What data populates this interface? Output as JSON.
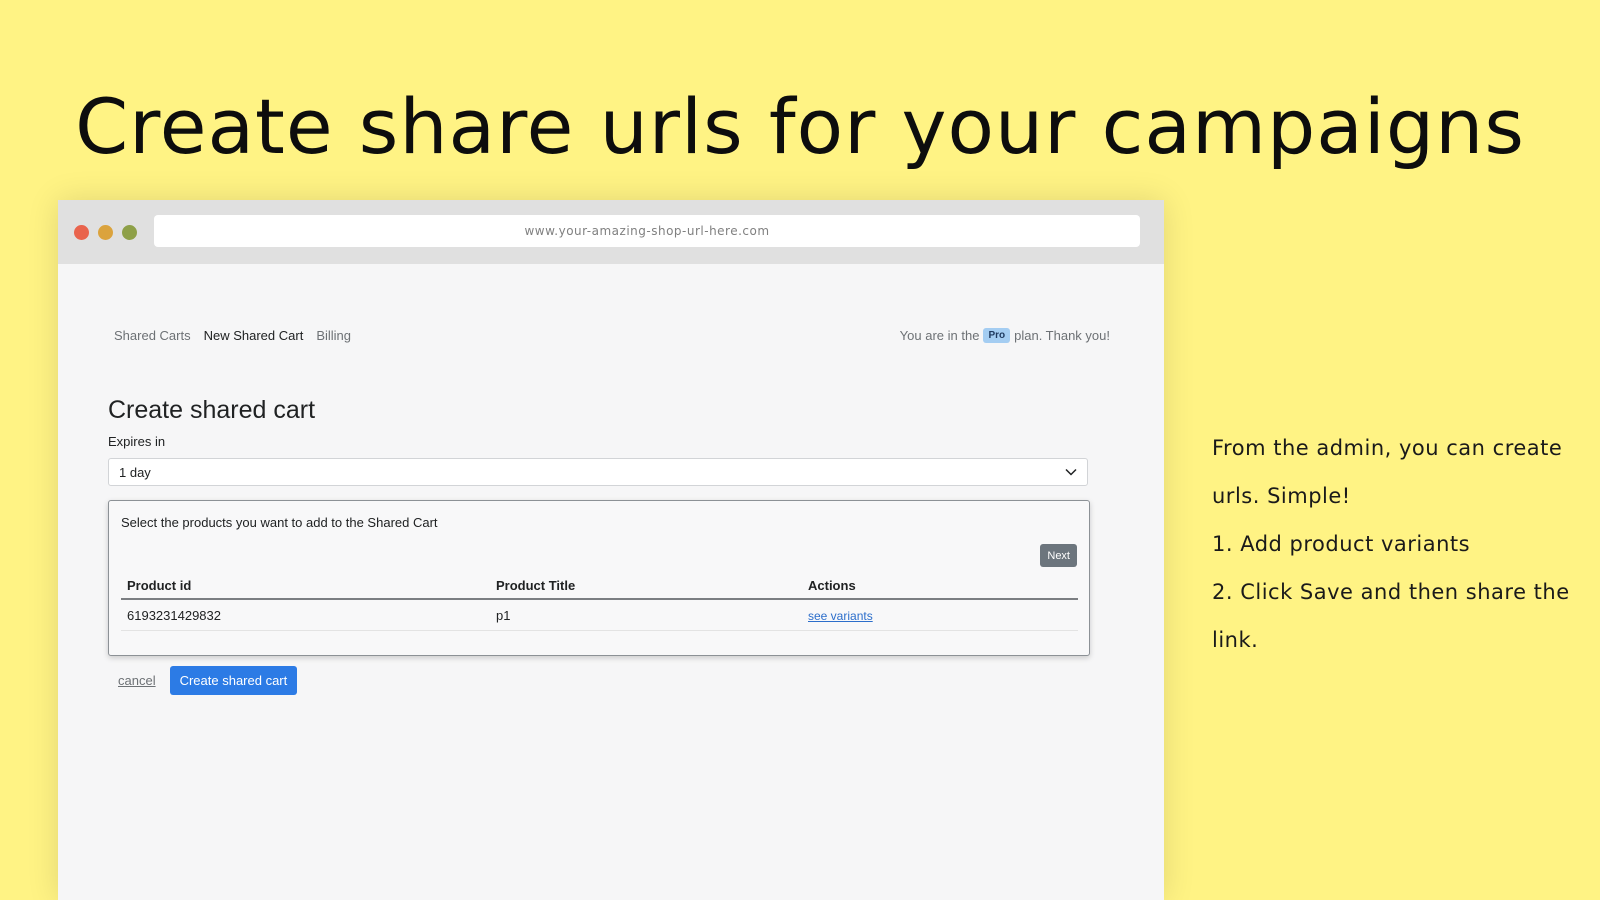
{
  "headline": "Create share urls for your campaigns",
  "browser": {
    "url": "www.your-amazing-shop-url-here.com"
  },
  "nav": {
    "items": [
      "Shared Carts",
      "New Shared Cart",
      "Billing"
    ],
    "active": "New Shared Cart"
  },
  "plan": {
    "prefix": "You are in the",
    "badge": "Pro",
    "suffix": "plan. Thank you!"
  },
  "form": {
    "title": "Create shared cart",
    "expires_label": "Expires in",
    "expires_value": "1 day",
    "products_intro": "Select the products you want to add to the Shared Cart",
    "next_label": "Next",
    "table": {
      "headers": [
        "Product id",
        "Product Title",
        "Actions"
      ],
      "rows": [
        {
          "id": "6193231429832",
          "title": "p1",
          "action": "see variants"
        }
      ]
    },
    "cancel_label": "cancel",
    "submit_label": "Create shared cart"
  },
  "side_text": {
    "intro": "From the admin, you can create urls. Simple!",
    "step1": "1. Add product variants",
    "step2": "2. Click Save and then share the link."
  },
  "colors": {
    "background": "#fff384",
    "primary_button": "#2c7be5",
    "link": "#2c6ecb",
    "badge": "#a4cdf2"
  }
}
